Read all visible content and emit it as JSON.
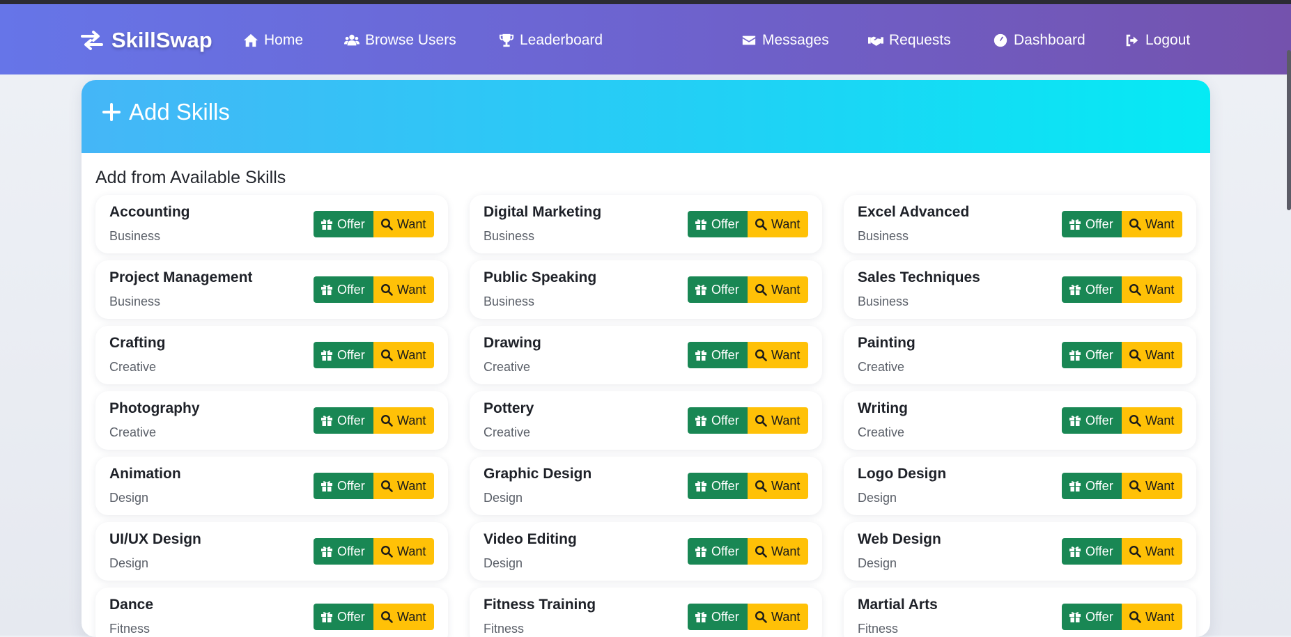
{
  "navbar": {
    "brand": "SkillSwap",
    "links": [
      {
        "label": "Home",
        "icon": "home-icon"
      },
      {
        "label": "Browse Users",
        "icon": "users-icon"
      },
      {
        "label": "Leaderboard",
        "icon": "trophy-icon"
      },
      {
        "label": "Messages",
        "icon": "envelope-icon"
      },
      {
        "label": "Requests",
        "icon": "handshake-icon"
      },
      {
        "label": "Dashboard",
        "icon": "gauge-icon"
      },
      {
        "label": "Logout",
        "icon": "logout-icon"
      }
    ]
  },
  "card": {
    "title": "Add Skills",
    "section_title": "Add from Available Skills",
    "offer_label": "Offer",
    "want_label": "Want"
  },
  "skills": [
    {
      "name": "Accounting",
      "category": "Business"
    },
    {
      "name": "Digital Marketing",
      "category": "Business"
    },
    {
      "name": "Excel Advanced",
      "category": "Business"
    },
    {
      "name": "Project Management",
      "category": "Business"
    },
    {
      "name": "Public Speaking",
      "category": "Business"
    },
    {
      "name": "Sales Techniques",
      "category": "Business"
    },
    {
      "name": "Crafting",
      "category": "Creative"
    },
    {
      "name": "Drawing",
      "category": "Creative"
    },
    {
      "name": "Painting",
      "category": "Creative"
    },
    {
      "name": "Photography",
      "category": "Creative"
    },
    {
      "name": "Pottery",
      "category": "Creative"
    },
    {
      "name": "Writing",
      "category": "Creative"
    },
    {
      "name": "Animation",
      "category": "Design"
    },
    {
      "name": "Graphic Design",
      "category": "Design"
    },
    {
      "name": "Logo Design",
      "category": "Design"
    },
    {
      "name": "UI/UX Design",
      "category": "Design"
    },
    {
      "name": "Video Editing",
      "category": "Design"
    },
    {
      "name": "Web Design",
      "category": "Design"
    },
    {
      "name": "Dance",
      "category": "Fitness"
    },
    {
      "name": "Fitness Training",
      "category": "Fitness"
    },
    {
      "name": "Martial Arts",
      "category": "Fitness"
    }
  ],
  "colors": {
    "offer": "#198754",
    "want": "#ffc107"
  }
}
